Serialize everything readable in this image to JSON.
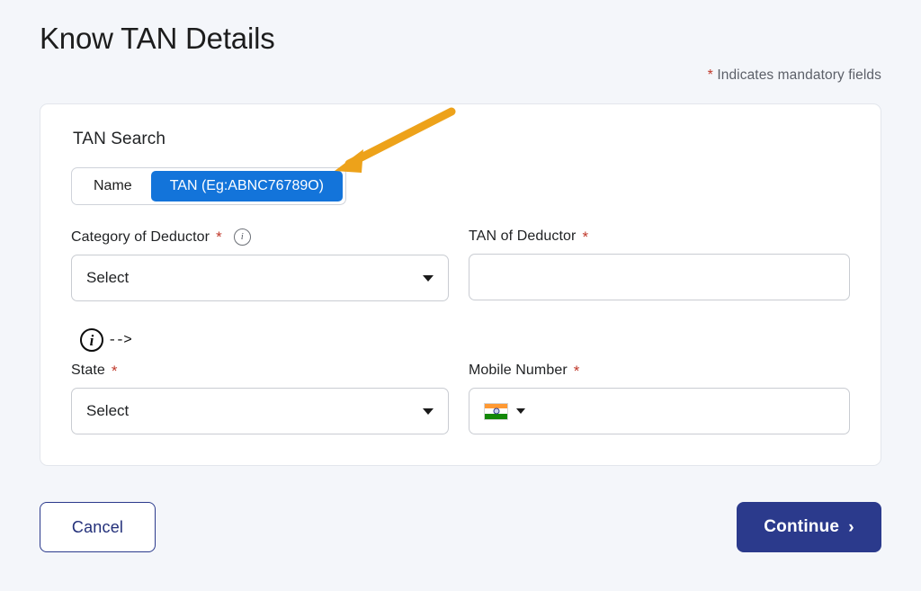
{
  "page": {
    "title": "Know TAN Details",
    "mandatory_note": "Indicates mandatory fields",
    "mandatory_star": "*",
    "background_color": "#f4f6fa"
  },
  "card": {
    "section_title": "TAN Search",
    "search_toggle": {
      "name": "search-mode-toggle",
      "options": [
        {
          "label": "Name",
          "selected": false
        },
        {
          "label": "TAN (Eg:ABNC76789O)",
          "selected": true
        }
      ],
      "active_color": "#1374da"
    },
    "fields": {
      "category_of_deductor": {
        "label": "Category of Deductor",
        "required_star": "*",
        "info_icon": "info-icon",
        "value": "Select",
        "caret_icon": "chevron-down-icon"
      },
      "tan_of_deductor": {
        "label": "TAN of Deductor",
        "required_star": "*",
        "value": "",
        "placeholder": ""
      },
      "state": {
        "label": "State",
        "required_star": "*",
        "value": "Select",
        "caret_icon": "chevron-down-icon",
        "annotation_icon": "info-icon",
        "annotation_arrow": "-->"
      },
      "mobile_number": {
        "label": "Mobile Number",
        "required_star": "*",
        "country_flag": "india-flag-icon",
        "caret_icon": "chevron-down-icon",
        "value": "",
        "placeholder": ""
      }
    }
  },
  "footer": {
    "cancel_label": "Cancel",
    "continue_label": "Continue",
    "continue_chevron": "›",
    "continue_color": "#2b3a8c"
  },
  "annotations": {
    "arrow_color": "#eda21a",
    "arrow_target": "search-mode-toggle-tan"
  }
}
